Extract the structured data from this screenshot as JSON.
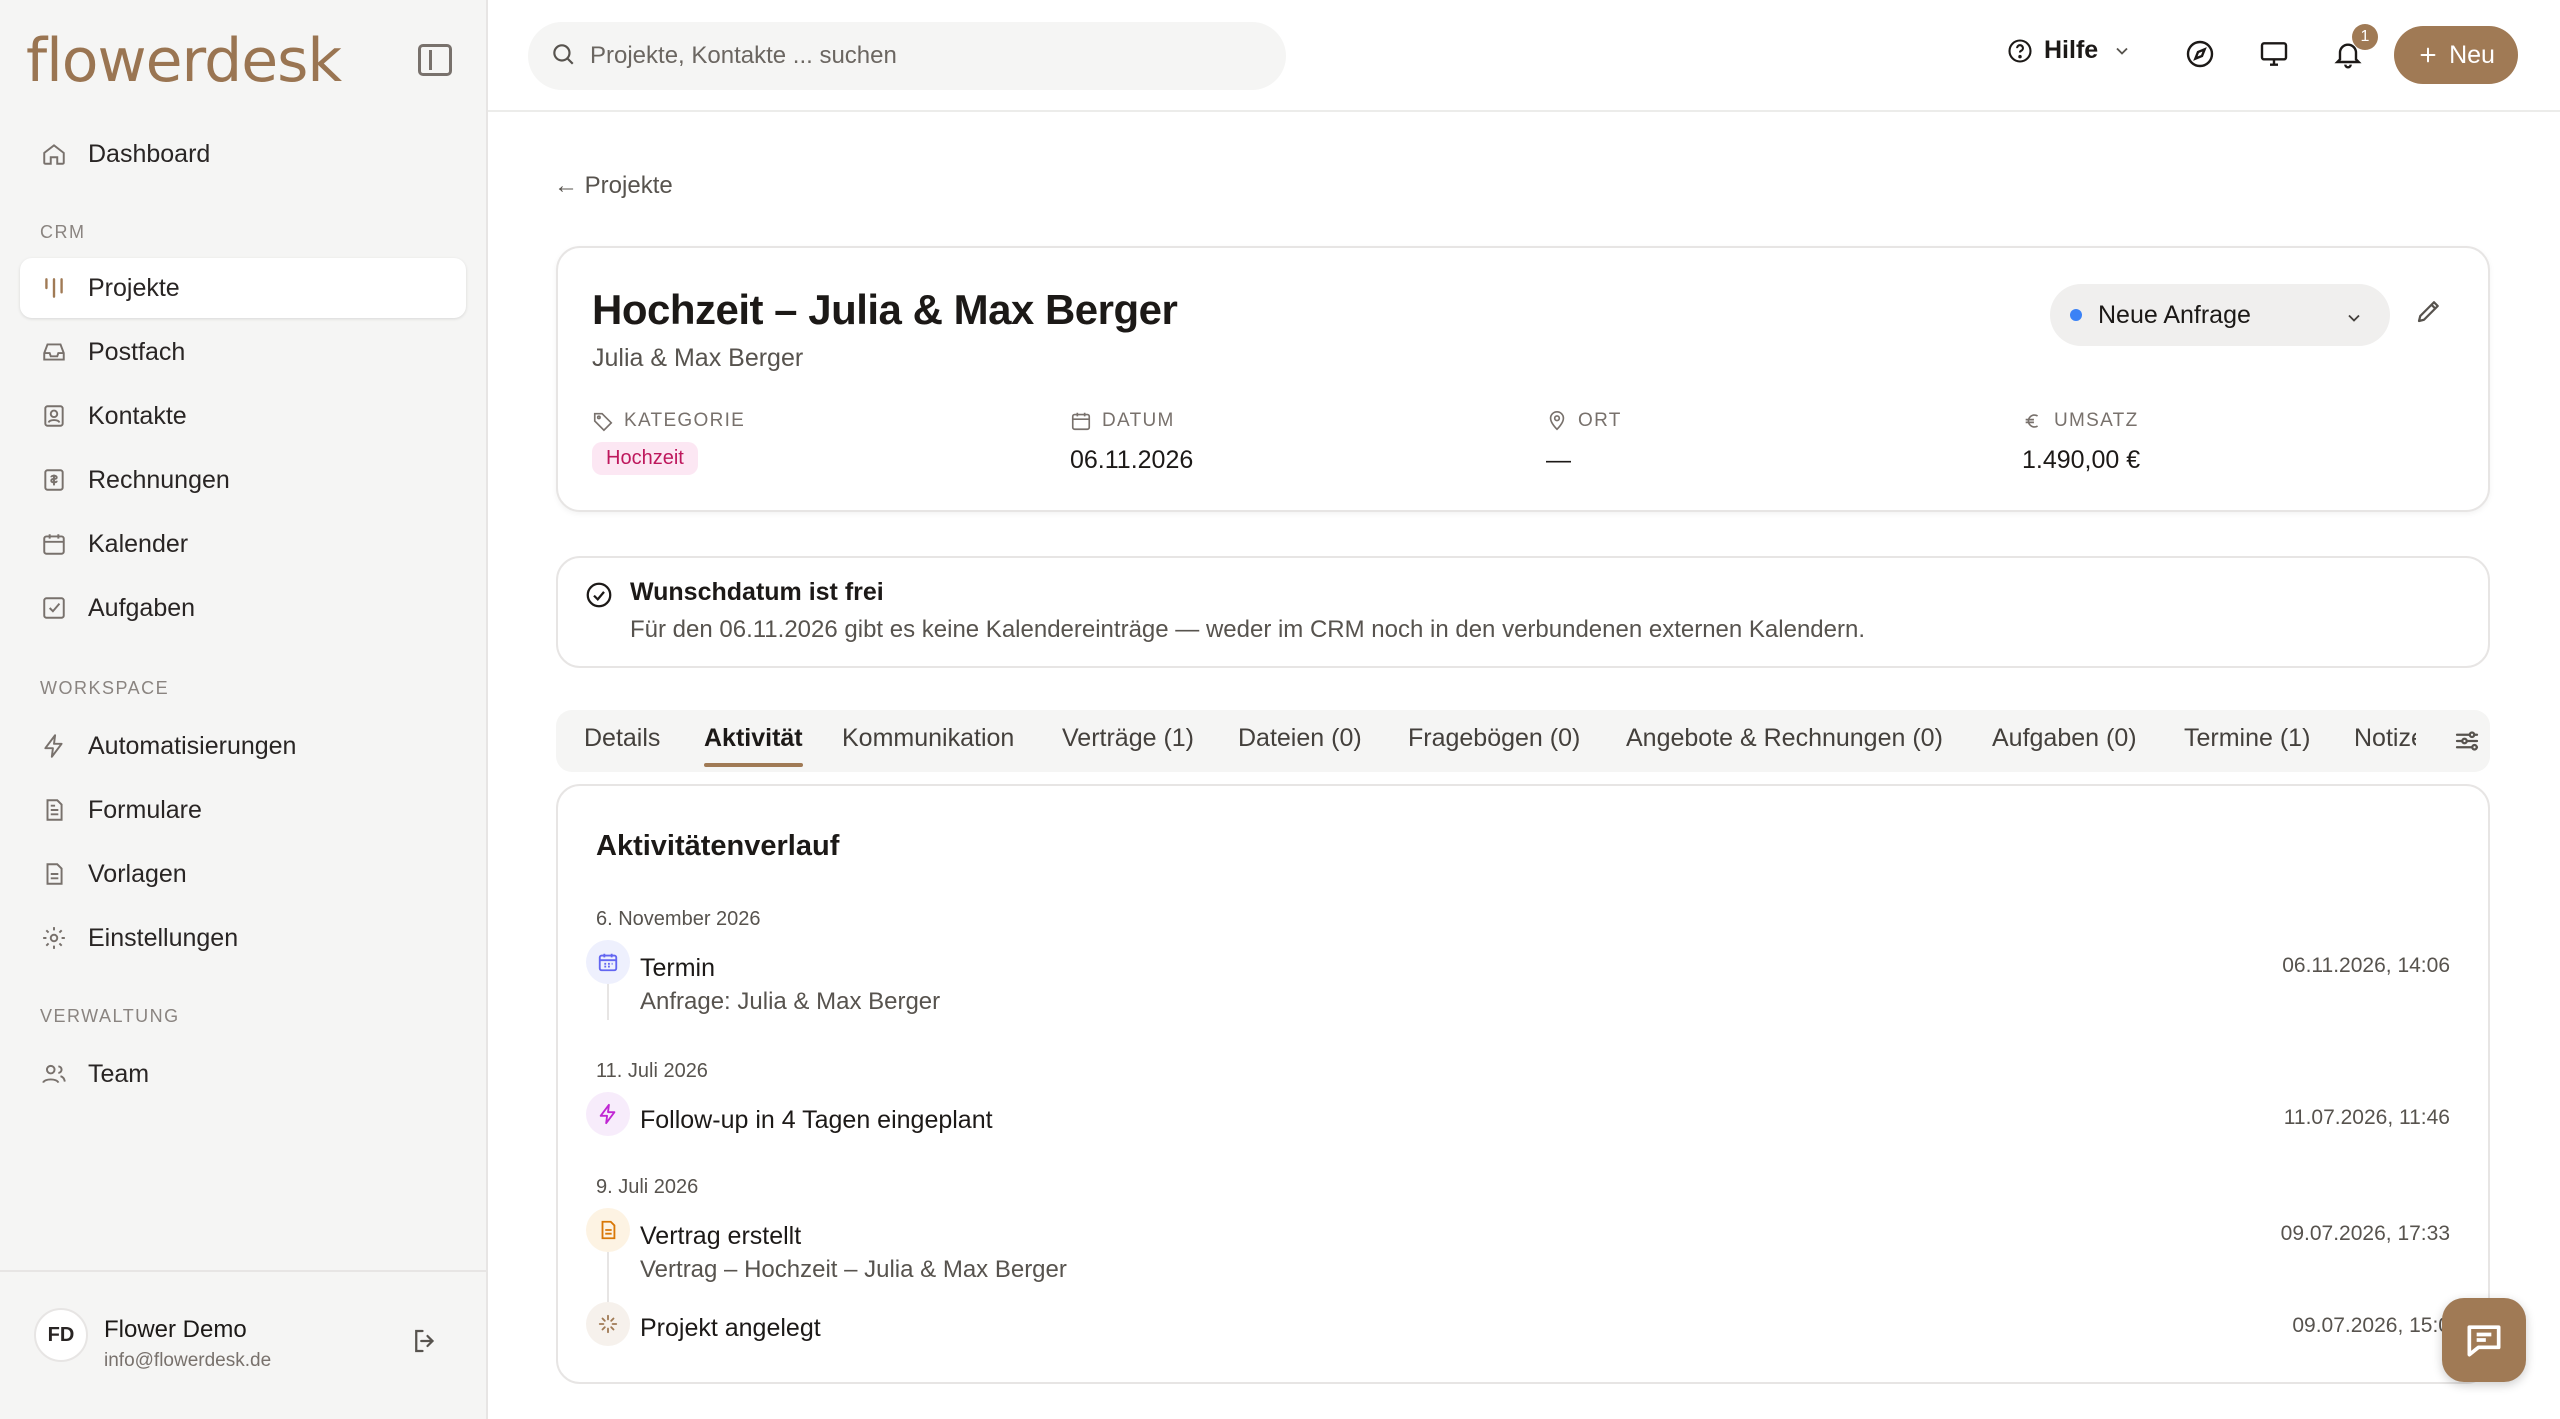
{
  "app": {
    "logo": "flowerdesk"
  },
  "sidebar": {
    "dashboard": "Dashboard",
    "sections": {
      "crm": "CRM",
      "workspace": "WORKSPACE",
      "verwaltung": "VERWALTUNG"
    },
    "crm_items": [
      {
        "label": "Projekte",
        "icon": "projects-icon",
        "active": true
      },
      {
        "label": "Postfach",
        "icon": "inbox-icon"
      },
      {
        "label": "Kontakte",
        "icon": "contacts-icon"
      },
      {
        "label": "Rechnungen",
        "icon": "invoice-icon"
      },
      {
        "label": "Kalender",
        "icon": "calendar-icon"
      },
      {
        "label": "Aufgaben",
        "icon": "tasks-icon"
      }
    ],
    "workspace_items": [
      {
        "label": "Automatisierungen",
        "icon": "lightning-icon"
      },
      {
        "label": "Formulare",
        "icon": "form-icon"
      },
      {
        "label": "Vorlagen",
        "icon": "template-icon"
      },
      {
        "label": "Einstellungen",
        "icon": "gear-icon"
      }
    ],
    "verwaltung_items": [
      {
        "label": "Team",
        "icon": "team-icon"
      }
    ],
    "user": {
      "initials": "FD",
      "name": "Flower Demo",
      "email": "info@flowerdesk.de"
    }
  },
  "topbar": {
    "search_placeholder": "Projekte, Kontakte ... suchen",
    "help_label": "Hilfe",
    "notification_count": "1",
    "new_label": "Neu"
  },
  "breadcrumb": {
    "back_label": "← Projekte"
  },
  "project": {
    "title": "Hochzeit – Julia & Max Berger",
    "subtitle": "Julia & Max Berger",
    "status": "Neue Anfrage",
    "meta": {
      "kategorie_label": "KATEGORIE",
      "kategorie_value": "Hochzeit",
      "datum_label": "DATUM",
      "datum_value": "06.11.2026",
      "ort_label": "ORT",
      "ort_value": "—",
      "umsatz_label": "UMSATZ",
      "umsatz_value": "1.490,00 €"
    }
  },
  "availability": {
    "title": "Wunschdatum ist frei",
    "text": "Für den 06.11.2026 gibt es keine Kalendereinträge — weder im CRM noch in den verbundenen externen Kalendern."
  },
  "tabs": [
    "Details",
    "Aktivität",
    "Kommunikation",
    "Verträge (1)",
    "Dateien (0)",
    "Fragebögen (0)",
    "Angebote & Rechnungen (0)",
    "Aufgaben (0)",
    "Termine (1)",
    "Notizen"
  ],
  "activity": {
    "title": "Aktivitätenverlauf",
    "groups": [
      {
        "date": "6. November 2026",
        "items": [
          {
            "title": "Termin",
            "sub": "Anfrage: Julia & Max Berger",
            "time": "06.11.2026, 14:06",
            "icon": "calendar-icon"
          }
        ]
      },
      {
        "date": "11. Juli 2026",
        "items": [
          {
            "title": "Follow-up in 4 Tagen eingeplant",
            "time": "11.07.2026, 11:46",
            "icon": "lightning-icon"
          }
        ]
      },
      {
        "date": "9. Juli 2026",
        "items": [
          {
            "title": "Vertrag erstellt",
            "sub": "Vertrag – Hochzeit – Julia & Max Berger",
            "time": "09.07.2026, 17:33",
            "icon": "document-icon"
          },
          {
            "title": "Projekt angelegt",
            "time": "09.07.2026, 15:0",
            "icon": "sparkle-icon"
          }
        ]
      }
    ]
  },
  "colors": {
    "brand": "#a07a55",
    "status_dot": "#3b82f6",
    "tag_bg": "#fce7f3",
    "tag_text": "#be185d"
  }
}
